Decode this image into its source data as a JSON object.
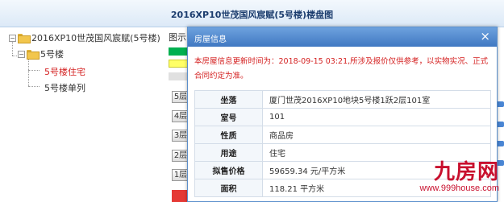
{
  "header": {
    "title": "2016XP10世茂国风宸赋(5号楼)楼盘图"
  },
  "tree": {
    "root": "2016XP10世茂国风宸赋(5号楼)",
    "building": "5号楼",
    "items": [
      "5号楼住宅",
      "5号楼单列"
    ]
  },
  "background": {
    "legend_label": "图示",
    "floor_buttons": [
      "5层",
      "4层",
      "3层",
      "2层",
      "1层"
    ],
    "colors": {
      "green": "#00b050",
      "yellow": "#ffff66",
      "red": "#e53935"
    }
  },
  "dialog": {
    "title": "房屋信息",
    "close": "×",
    "notice": "本房屋信息更新时间为：2018-09-15 03:21,所涉及报价仅供参考，以实物实况、正式合同约定为准。",
    "rows": [
      {
        "key": "坐落",
        "value": "厦门世茂2016XP10地块5号楼1跃2层101室"
      },
      {
        "key": "室号",
        "value": "101"
      },
      {
        "key": "性质",
        "value": "商品房"
      },
      {
        "key": "用途",
        "value": "住宅"
      },
      {
        "key": "拟售价格",
        "value": "59659.34 元/平方米"
      },
      {
        "key": "面积",
        "value": "118.21 平方米"
      }
    ]
  },
  "watermark": {
    "logo": "九房网",
    "url": "www.999house.com"
  }
}
